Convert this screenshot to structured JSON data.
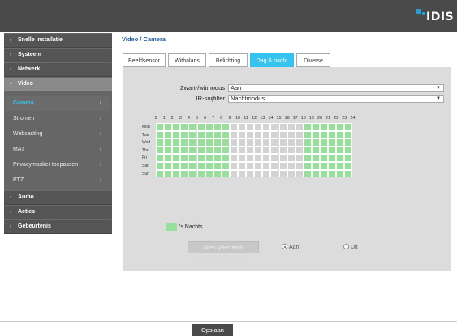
{
  "header": {
    "logo_text": "IDIS",
    "bg_color": "#4a4a4a",
    "accent": "#1fa0d8"
  },
  "sidebar": {
    "items": [
      {
        "label": "Snelle installatie",
        "active": false
      },
      {
        "label": "Systeem",
        "active": false
      },
      {
        "label": "Netwerk",
        "active": false
      },
      {
        "label": "Video",
        "active": true
      },
      {
        "label": "Audio",
        "active": false
      },
      {
        "label": "Acties",
        "active": false
      },
      {
        "label": "Gebeurtenis",
        "active": false
      }
    ],
    "video_subitems": [
      {
        "label": "Camera",
        "active": true
      },
      {
        "label": "Stromen",
        "active": false
      },
      {
        "label": "Webcasting",
        "active": false
      },
      {
        "label": "MAT",
        "active": false
      },
      {
        "label": "Privacymasker toepassen",
        "active": false
      },
      {
        "label": "PTZ",
        "active": false
      }
    ]
  },
  "main": {
    "breadcrumb": "Video / Camera",
    "tabs": [
      {
        "label": "Beeldsensor",
        "active": false
      },
      {
        "label": "Witbalans",
        "active": false
      },
      {
        "label": "Belichting",
        "active": false
      },
      {
        "label": "Dag & nacht",
        "active": true
      },
      {
        "label": "Diverse",
        "active": false
      }
    ],
    "fields": {
      "bw_mode_label": "Zwart-/witmodus",
      "bw_mode_value": "Aan",
      "ir_filter_label": "IR-snijfilter",
      "ir_filter_value": "Nachtmodus"
    },
    "schedule": {
      "hours": [
        "0",
        "1",
        "2",
        "3",
        "4",
        "5",
        "6",
        "7",
        "8",
        "9",
        "10",
        "11",
        "12",
        "13",
        "14",
        "15",
        "16",
        "17",
        "18",
        "19",
        "20",
        "21",
        "22",
        "23",
        "24"
      ],
      "days": [
        "Mon",
        "Tue",
        "Wed",
        "Thu",
        "Fri",
        "Sat",
        "Sun"
      ],
      "night_hours": [
        0,
        1,
        2,
        3,
        4,
        5,
        6,
        7,
        8,
        18,
        19,
        20,
        21,
        22,
        23
      ],
      "night_color": "#98df9c",
      "day_color": "#d3d3d3"
    },
    "legend_label": "'s Nachts",
    "select_all_label": "Alles selecteren",
    "radio_on_label": "Aan",
    "radio_off_label": "Uit",
    "radio_selected": "on"
  },
  "footer": {
    "save_label": "Opslaan"
  }
}
